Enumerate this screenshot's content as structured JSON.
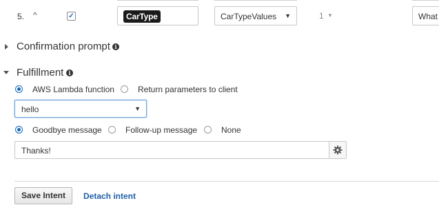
{
  "slot_row": {
    "priority": "5.",
    "required_checked": true,
    "slot_name": "CarType",
    "slot_type": "CarTypeValues",
    "version": "1",
    "prompt": "What t"
  },
  "confirmation": {
    "title": "Confirmation prompt",
    "expanded": false
  },
  "fulfillment": {
    "title": "Fulfillment",
    "expanded": true,
    "options": [
      {
        "label": "AWS Lambda function",
        "selected": true
      },
      {
        "label": "Return parameters to client",
        "selected": false
      }
    ],
    "lambda_function": "hello",
    "message_options": [
      {
        "label": "Goodbye message",
        "selected": true
      },
      {
        "label": "Follow-up message",
        "selected": false
      },
      {
        "label": "None",
        "selected": false
      }
    ],
    "message_value": "Thanks!"
  },
  "footer": {
    "save_label": "Save Intent",
    "detach_label": "Detach intent"
  },
  "colors": {
    "accent": "#1166bb",
    "link": "#1f5fa8"
  }
}
